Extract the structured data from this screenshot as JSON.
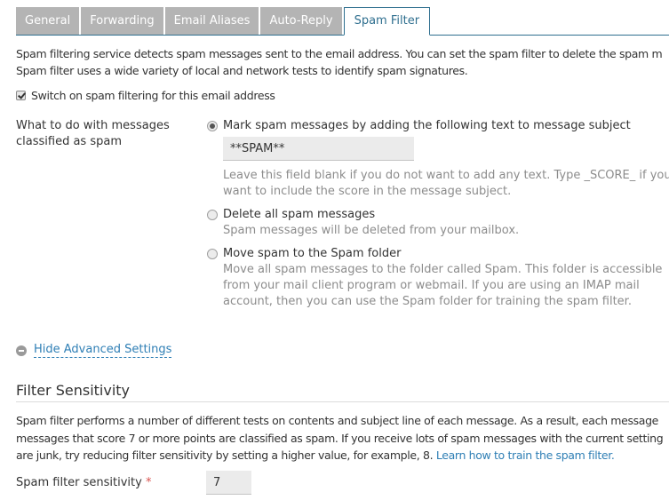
{
  "tabs": [
    {
      "label": "General",
      "active": false
    },
    {
      "label": "Forwarding",
      "active": false
    },
    {
      "label": "Email Aliases",
      "active": false
    },
    {
      "label": "Auto-Reply",
      "active": false
    },
    {
      "label": "Spam Filter",
      "active": true
    }
  ],
  "intro": {
    "line1": "Spam filtering service detects spam messages sent to the email address. You can set the spam filter to delete the spam m",
    "line2": "Spam filter uses a wide variety of local and network tests to identify spam signatures."
  },
  "switch_spam": {
    "label": "Switch on spam filtering for this email address",
    "checked": true
  },
  "action": {
    "label": "What to do with messages classified as spam",
    "options": [
      {
        "label": "Mark spam messages by adding the following text to message subject",
        "checked": true,
        "input_value": "**SPAM**",
        "hint": "Leave this field blank if you do not want to add any text. Type _SCORE_ if you want to include the score in the message subject."
      },
      {
        "label": "Delete all spam messages",
        "checked": false,
        "hint": "Spam messages will be deleted from your mailbox."
      },
      {
        "label": "Move spam to the Spam folder",
        "checked": false,
        "hint": "Move all spam messages to the folder called Spam. This folder is accessible from your mail client program or webmail. If you are using an IMAP mail account, then you can use the Spam folder for training the spam filter."
      }
    ]
  },
  "advanced": {
    "label": "Hide Advanced Settings"
  },
  "sensitivity": {
    "title": "Filter Sensitivity",
    "desc_line1": "Spam filter performs a number of different tests on contents and subject line of each message. As a result, each message",
    "desc_line2": "messages that score 7 or more points are classified as spam. If you receive lots of spam messages with the current setting",
    "desc_line3": "are junk, try reducing filter sensitivity by setting a higher value, for example, 8.",
    "link": "Learn how to train the spam filter.",
    "field_label": "Spam filter sensitivity",
    "required_mark": "*",
    "value": "7"
  },
  "colors": {
    "accent": "#2f6f8f",
    "link": "#2f7fb5",
    "tab_inactive": "#b4b4b4",
    "required": "#d9534f"
  }
}
